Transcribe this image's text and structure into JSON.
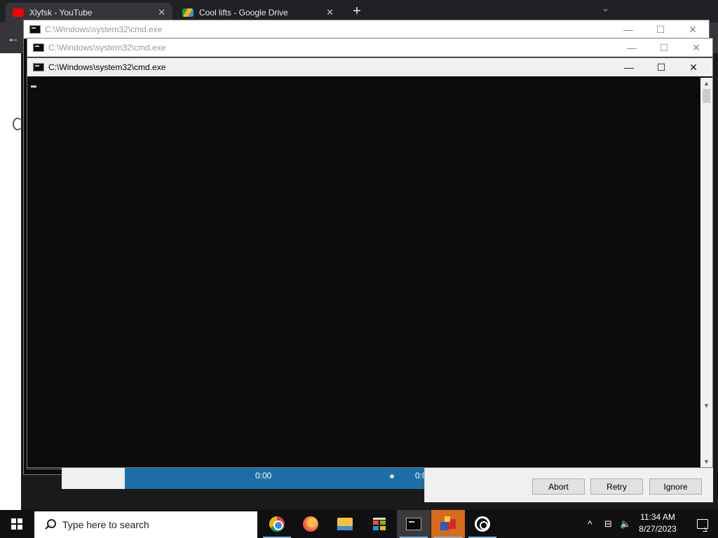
{
  "browser": {
    "tabs": [
      {
        "label": "Xlyfsk - YouTube",
        "close": "✕"
      },
      {
        "label": "Cool lifts - Google Drive",
        "close": "✕"
      }
    ],
    "new_tab": "+",
    "back": "←"
  },
  "cmd_windows": [
    {
      "title": "C:\\Windows\\system32\\cmd.exe"
    },
    {
      "title": "C:\\Windows\\system32\\cmd.exe"
    },
    {
      "title": "C:\\Windows\\system32\\cmd.exe"
    }
  ],
  "window_controls": {
    "minimize": "—",
    "maximize": "☐",
    "close": "✕"
  },
  "scrollbar": {
    "up": "▲",
    "down": "▼"
  },
  "media": {
    "time_left": "0:00",
    "time_right": "0:0"
  },
  "dialog": {
    "abort": "Abort",
    "retry": "Retry",
    "ignore": "Ignore"
  },
  "taskbar": {
    "search_placeholder": "Type here to search",
    "apps": [
      "chrome-icon",
      "firefox-icon",
      "file-explorer-icon",
      "microsoft-store-icon",
      "command-prompt-icon",
      "box-app-icon",
      "target-app-icon"
    ],
    "tray_chevron": "^",
    "time": "11:34 AM",
    "date": "8/27/2023"
  }
}
